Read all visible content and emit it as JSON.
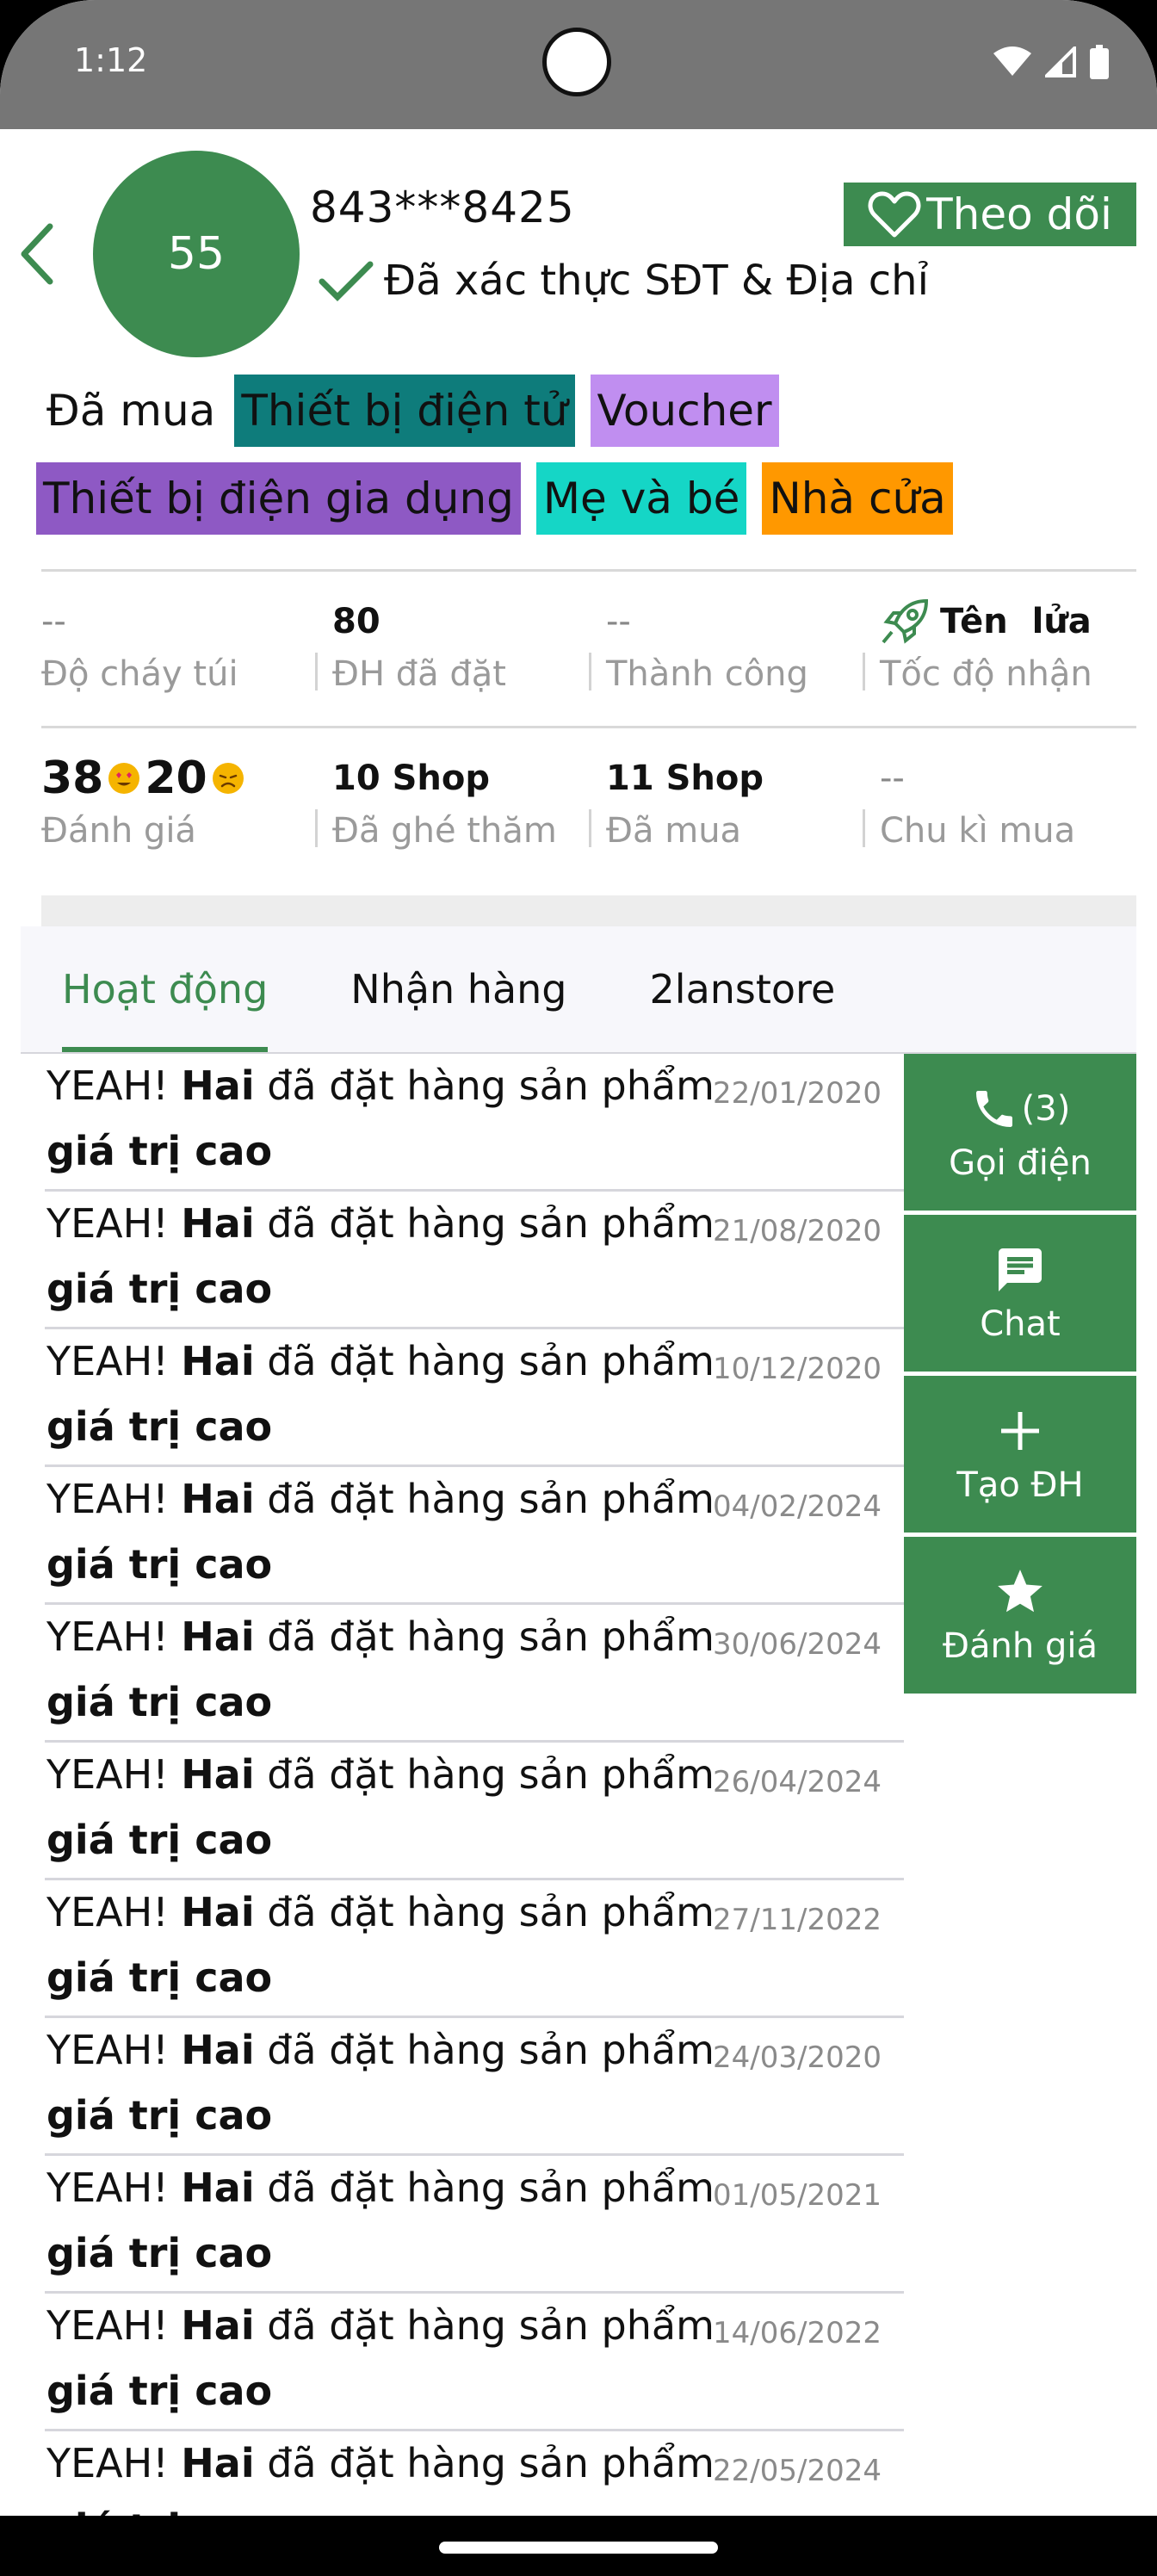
{
  "status_bar": {
    "time": "1:12",
    "icons": [
      "wifi-icon",
      "signal-icon",
      "battery-icon"
    ]
  },
  "colors": {
    "accent": "#3d8b50",
    "tag_teal": "#0e7c7b",
    "tag_purple": "#c08ef0",
    "tag_violet": "#8e59c4",
    "tag_cyan": "#15d6c6",
    "tag_orange": "#ff9800"
  },
  "profile": {
    "avatar_text": "55",
    "phone": "843***8425",
    "verified_text": "Đã xác thực SĐT & Địa chỉ",
    "follow_label": "Theo dõi"
  },
  "purchased": {
    "label": "Đã mua",
    "tags": [
      "Thiết bị điện tử",
      "Voucher",
      "Thiết bị điện gia dụng",
      "Mẹ và bé",
      "Nhà cửa"
    ]
  },
  "stats_row1": [
    {
      "value": "--",
      "label": "Độ cháy túi"
    },
    {
      "value": "80",
      "label": "ĐH đã đặt"
    },
    {
      "value": "--",
      "label": "Thành công"
    },
    {
      "value": "Tên  lửa",
      "label": "Tốc độ nhận",
      "icon": "rocket-icon"
    }
  ],
  "stats_row2": [
    {
      "value_positive": "38",
      "value_negative": "20",
      "label": "Đánh giá"
    },
    {
      "value": "10 Shop",
      "label": "Đã ghé thăm"
    },
    {
      "value": "11 Shop",
      "label": "Đã mua"
    },
    {
      "value": "--",
      "label": "Chu kì mua"
    }
  ],
  "tabs": [
    {
      "label": "Hoạt động",
      "active": true
    },
    {
      "label": "Nhận hàng",
      "active": false
    },
    {
      "label": "2lanstore",
      "active": false
    }
  ],
  "activity": {
    "prefix": "YEAH! ",
    "name": "Hai",
    "action": " đã đặt hàng sản phẩm",
    "detail": "giá trị cao",
    "dates": [
      "22/01/2020",
      "21/08/2020",
      "10/12/2020",
      "04/02/2024",
      "30/06/2024",
      "26/04/2024",
      "27/11/2022",
      "24/03/2020",
      "01/05/2021",
      "14/06/2022",
      "22/05/2024"
    ]
  },
  "actions": {
    "call": {
      "label": "Gọi điện",
      "count": "(3)"
    },
    "chat": {
      "label": "Chat"
    },
    "create_order": {
      "label": "Tạo ĐH"
    },
    "rate": {
      "label": "Đánh giá"
    }
  }
}
